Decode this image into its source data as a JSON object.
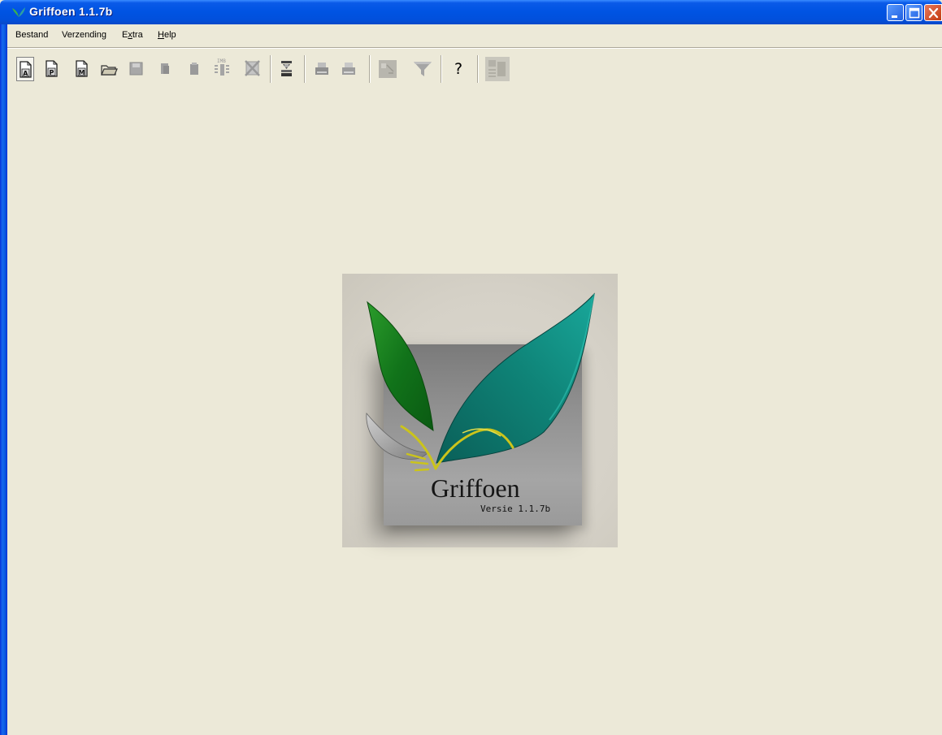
{
  "window": {
    "title": "Griffoen 1.1.7b",
    "buttons": {
      "minimize": "minimize",
      "maximize": "maximize",
      "close": "close"
    }
  },
  "menu": [
    {
      "label": "Bestand",
      "mnemonic_underline": false
    },
    {
      "label": "Verzending",
      "mnemonic_underline": false
    },
    {
      "pre": "E",
      "u": "x",
      "post": "tra"
    },
    {
      "pre": "",
      "u": "H",
      "post": "elp"
    }
  ],
  "toolbar": {
    "items": [
      {
        "icon": "document-a-icon",
        "label": "A",
        "enabled": true,
        "active": true
      },
      {
        "icon": "document-p-icon",
        "label": "P",
        "enabled": true
      },
      {
        "icon": "document-m-icon",
        "label": "M",
        "enabled": true
      },
      {
        "icon": "open-folder-icon",
        "enabled": true
      },
      {
        "icon": "save-icon",
        "enabled": false
      },
      {
        "icon": "copy-icon",
        "enabled": false
      },
      {
        "icon": "paste-icon",
        "enabled": false
      },
      {
        "icon": "imb-icon",
        "label": "IMB",
        "enabled": false
      },
      {
        "icon": "delete-icon",
        "enabled": false
      },
      {
        "icon": "import-icon",
        "enabled": true
      },
      {
        "icon": "print-icon",
        "enabled": false
      },
      {
        "icon": "print-preview-icon",
        "enabled": false
      },
      {
        "icon": "report-icon",
        "enabled": false
      },
      {
        "icon": "filter-icon",
        "enabled": false
      },
      {
        "icon": "help-icon",
        "label": "?",
        "enabled": true
      },
      {
        "icon": "settings-icon",
        "enabled": false
      }
    ]
  },
  "splash": {
    "name": "Griffoen",
    "version": "Versie 1.1.7b"
  },
  "colors": {
    "titlebar": "#0054e3",
    "background": "#ece9d8",
    "leaf_teal": "#0e8a7c",
    "leaf_green": "#1e7a1e",
    "accent_yellow": "#c9c21a"
  }
}
